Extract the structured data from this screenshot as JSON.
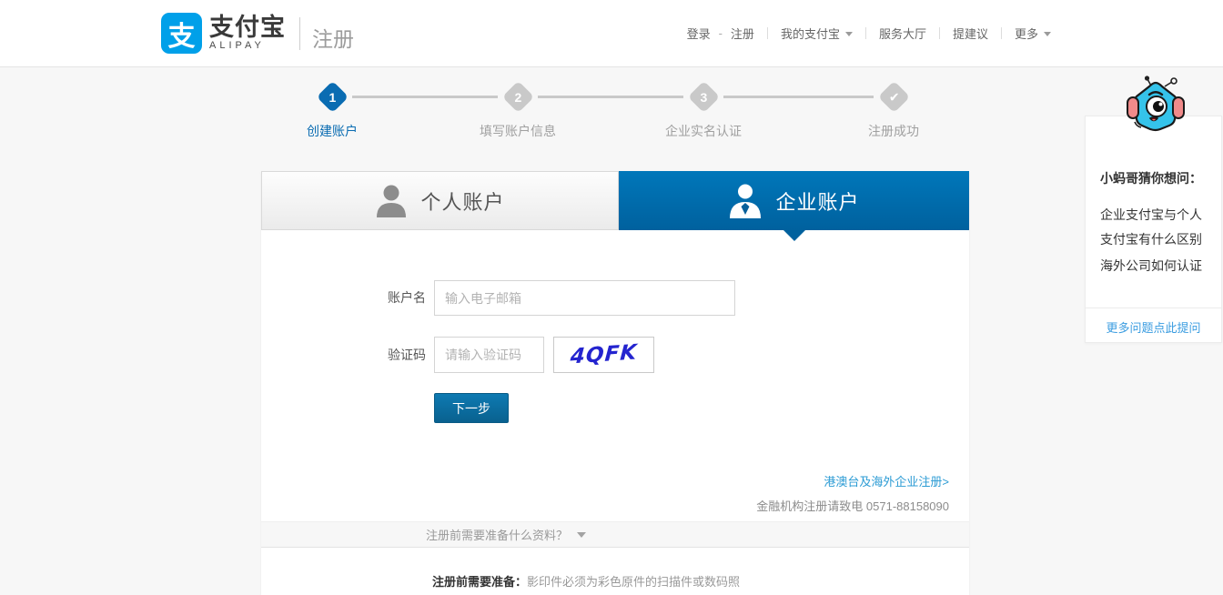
{
  "header": {
    "logo": {
      "icon_char": "支",
      "brand_cn": "支付宝",
      "brand_en": "ALIPAY",
      "page_title": "注册"
    },
    "nav": {
      "login": "登录",
      "dash": "-",
      "register": "注册",
      "my_alipay": "我的支付宝",
      "service_hall": "服务大厅",
      "suggestion": "提建议",
      "more": "更多"
    }
  },
  "steps": [
    {
      "num": "1",
      "label": "创建账户"
    },
    {
      "num": "2",
      "label": "填写账户信息"
    },
    {
      "num": "3",
      "label": "企业实名认证"
    },
    {
      "num": "✔",
      "label": "注册成功"
    }
  ],
  "tabs": {
    "personal": "个人账户",
    "enterprise": "企业账户"
  },
  "form": {
    "account_label": "账户名",
    "account_placeholder": "输入电子邮箱",
    "captcha_label": "验证码",
    "captcha_placeholder": "请输入验证码",
    "captcha_image_text": "4QFK",
    "submit_label": "下一步"
  },
  "links": {
    "overseas": "港澳台及海外企业注册>",
    "finance_note": "金融机构注册请致电 0571-88158090"
  },
  "prepare": {
    "toggle_label": "注册前需要准备什么资料？",
    "note_bold": "注册前需要准备：",
    "note_rest": "影印件必须为彩色原件的扫描件或数码照"
  },
  "sidebar": {
    "title": "小蚂哥猜你想问：",
    "questions": [
      "企业支付宝与个人支付宝有什么区别",
      "海外公司如何认证"
    ],
    "more_link": "更多问题点此提问"
  },
  "colors": {
    "brand_blue": "#00a0e9",
    "primary_blue": "#0070b4",
    "link_blue": "#2b9bd4",
    "captcha_text_blue": "#2424cf"
  }
}
